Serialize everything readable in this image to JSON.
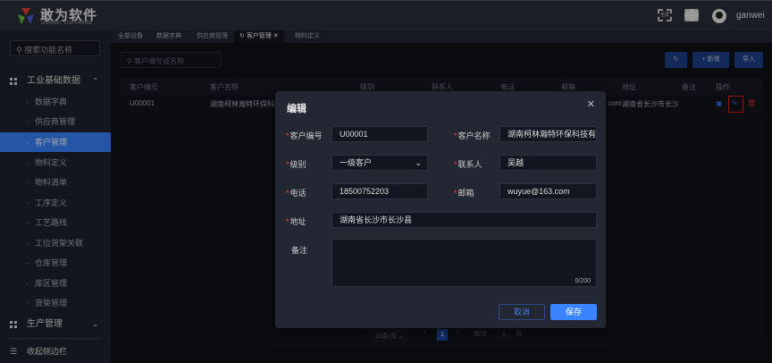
{
  "header": {
    "brand": "敢为软件",
    "brand_sub": "GANWEI SOFTWARE",
    "fullscreen_label": "全屏",
    "username": "ganwei"
  },
  "sidebar": {
    "search_placeholder": "搜索功能名称",
    "group1": "工业基础数据",
    "items": [
      "数据字典",
      "供应商管理",
      "客户管理",
      "物料定义",
      "物料清单",
      "工序定义",
      "工艺路线",
      "工位货架关联",
      "仓库管理",
      "库区管理",
      "货架管理"
    ],
    "group2": "生产管理",
    "collapse": "收起侧边栏"
  },
  "tabs": [
    "全部设备",
    "数据字典",
    "供应商管理",
    "客户管理",
    "物料定义"
  ],
  "toolbar": {
    "search_placeholder": "客户编号或名称",
    "add": "+ 新增",
    "import": "导入"
  },
  "table": {
    "headers": [
      "客户编号",
      "客户名称",
      "级别",
      "联系人",
      "电话",
      "邮箱",
      "地址",
      "备注",
      "操作"
    ],
    "row": {
      "code": "U00001",
      "name": "湖南柯林瀚特环保科技有限公司",
      "email_tail": "com",
      "address": "湖南省长沙市长沙县"
    }
  },
  "pager": {
    "size": "25条/页",
    "page": "1",
    "goto": "前往",
    "goto_value": "1",
    "page_unit": "页"
  },
  "modal": {
    "title": "编辑",
    "fields": {
      "code_label": "客户编号",
      "code": "U00001",
      "name_label": "客户名称",
      "name": "湖南柯林瀚特环保科技有限公司",
      "level_label": "级别",
      "level": "一级客户",
      "contact_label": "联系人",
      "contact": "吴越",
      "phone_label": "电话",
      "phone": "18500752203",
      "email_label": "邮箱",
      "email": "wuyue@163.com",
      "address_label": "地址",
      "address": "湖南省长沙市长沙县",
      "remark_label": "备注",
      "remark_count": "0/200"
    },
    "cancel": "取消",
    "save": "保存"
  }
}
